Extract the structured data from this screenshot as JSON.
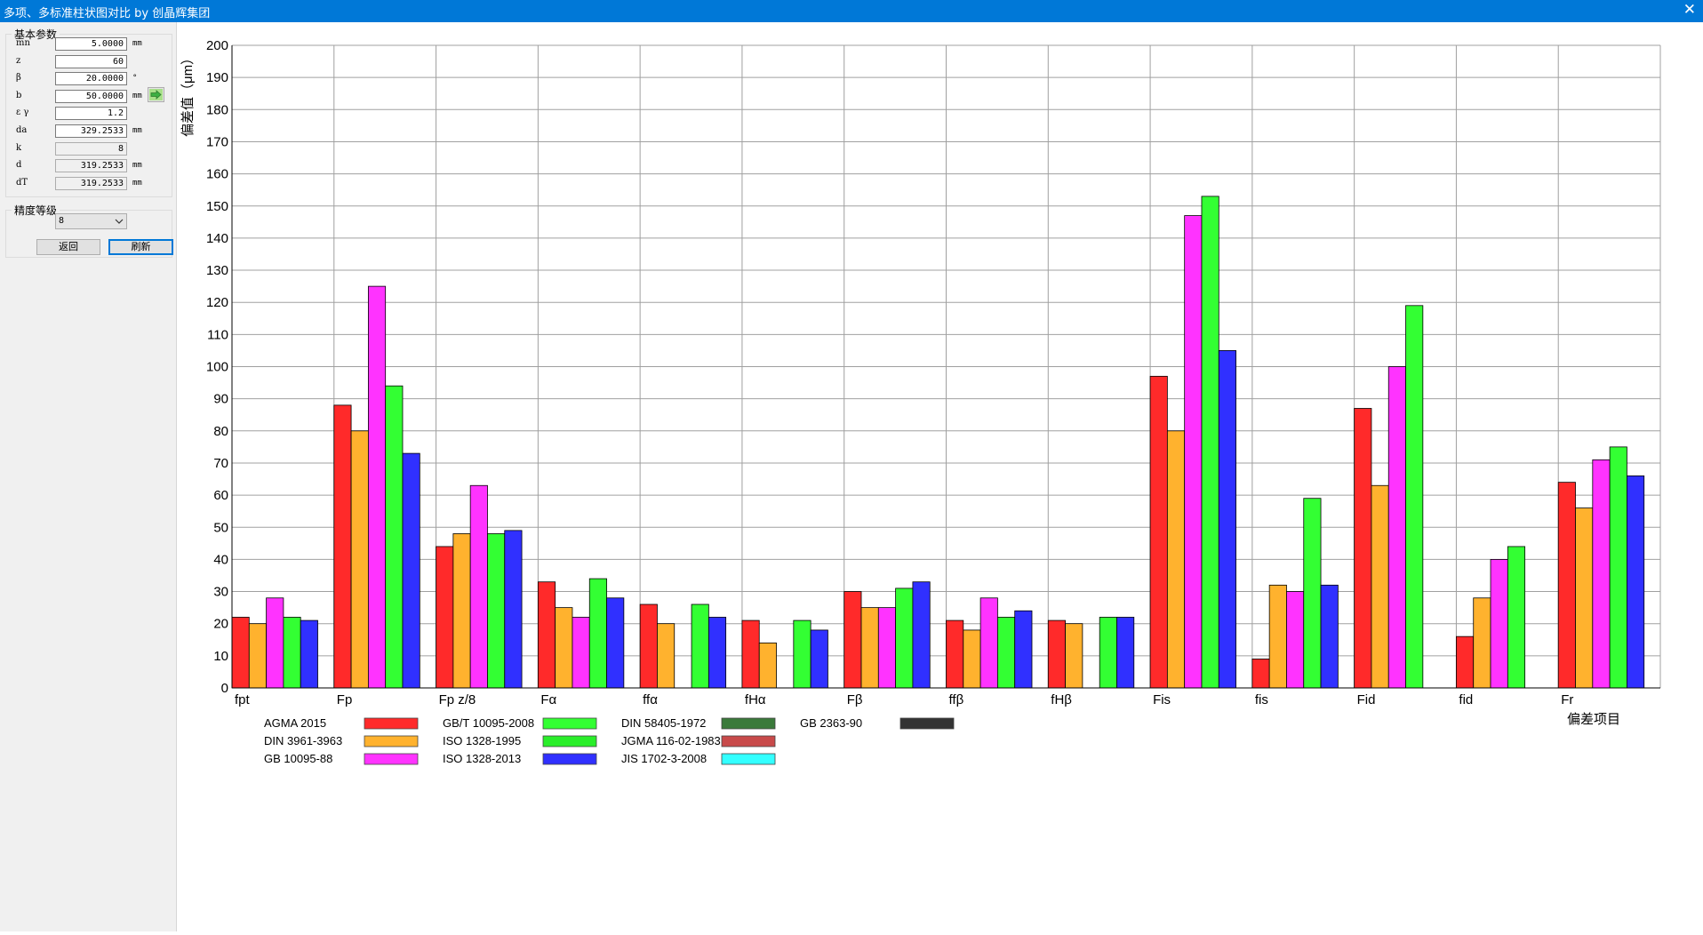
{
  "window": {
    "title": "多项、多标准柱状图对比 by 创晶辉集团",
    "close_label": "✕"
  },
  "params": {
    "group_title": "基本参数",
    "rows": [
      {
        "label": "mn",
        "value": "5.0000",
        "unit": "mm",
        "readonly": false
      },
      {
        "label": "z",
        "value": "60",
        "unit": "",
        "readonly": false
      },
      {
        "label": "β",
        "value": "20.0000",
        "unit": "°",
        "readonly": false
      },
      {
        "label": "b",
        "value": "50.0000",
        "unit": "mm",
        "readonly": false
      },
      {
        "label": "ε γ",
        "value": "1.2",
        "unit": "",
        "readonly": false
      },
      {
        "label": "da",
        "value": "329.2533",
        "unit": "mm",
        "readonly": false
      },
      {
        "label": "k",
        "value": "8",
        "unit": "",
        "readonly": true
      },
      {
        "label": "d",
        "value": "319.2533",
        "unit": "mm",
        "readonly": true
      },
      {
        "label": "dT",
        "value": "319.2533",
        "unit": "mm",
        "readonly": true
      }
    ],
    "go_icon": "green-arrow-right-icon"
  },
  "precision": {
    "group_title": "精度等级",
    "selected": "8"
  },
  "buttons": {
    "back": "返回",
    "refresh": "刷新"
  },
  "chart_data": {
    "type": "bar",
    "title": "",
    "ylabel": "偏差值（μm）",
    "xlabel": "偏差项目",
    "ylim": [
      0,
      200
    ],
    "ytick_step": 10,
    "grid": true,
    "legend_position": "bottom",
    "categories": [
      "fpt",
      "Fp",
      "Fp z/8",
      "Fα",
      "ffα",
      "fHα",
      "Fβ",
      "ffβ",
      "fHβ",
      "Fis",
      "fis",
      "Fid",
      "fid",
      "Fr"
    ],
    "series": [
      {
        "name": "AGMA 2015",
        "color": "#ff2a2a",
        "values": [
          22,
          88,
          44,
          33,
          26,
          21,
          30,
          21,
          21,
          97,
          9,
          87,
          16,
          64
        ]
      },
      {
        "name": "DIN 3961-3963",
        "color": "#ffb22e",
        "values": [
          20,
          80,
          48,
          25,
          20,
          14,
          25,
          18,
          20,
          80,
          32,
          63,
          28,
          56
        ]
      },
      {
        "name": "GB 10095-88",
        "color": "#ff33ff",
        "values": [
          28,
          125,
          63,
          22,
          null,
          null,
          25,
          28,
          null,
          147,
          30,
          100,
          40,
          71
        ]
      },
      {
        "name": "GB/T 10095-2008",
        "color": "#33ff33",
        "values": [
          22,
          94,
          48,
          34,
          26,
          21,
          31,
          22,
          22,
          153,
          59,
          119,
          44,
          75
        ]
      },
      {
        "name": "ISO 1328-1995",
        "color": "#2aee2a",
        "values": [
          null,
          null,
          null,
          null,
          null,
          null,
          null,
          null,
          null,
          null,
          null,
          null,
          null,
          null
        ]
      },
      {
        "name": "ISO 1328-2013",
        "color": "#3030ff",
        "values": [
          21,
          73,
          49,
          28,
          22,
          18,
          33,
          24,
          22,
          105,
          32,
          null,
          null,
          66
        ]
      },
      {
        "name": "DIN 58405-1972",
        "color": "#3a7a3a",
        "values": [
          null,
          null,
          null,
          null,
          null,
          null,
          null,
          null,
          null,
          null,
          null,
          null,
          null,
          null
        ]
      },
      {
        "name": "JGMA 116-02-1983",
        "color": "#c84a4a",
        "values": [
          null,
          null,
          null,
          null,
          null,
          null,
          null,
          null,
          null,
          null,
          null,
          null,
          null,
          null
        ]
      },
      {
        "name": "JIS 1702-3-2008",
        "color": "#33ffff",
        "values": [
          null,
          null,
          null,
          null,
          null,
          null,
          null,
          null,
          null,
          null,
          null,
          null,
          null,
          null
        ]
      },
      {
        "name": "GB 2363-90",
        "color": "#333333",
        "values": [
          null,
          null,
          null,
          null,
          null,
          null,
          null,
          null,
          null,
          null,
          null,
          null,
          null,
          null
        ]
      }
    ],
    "plotted_series": [
      "AGMA 2015",
      "DIN 3961-3963",
      "GB 10095-88",
      "GB/T 10095-2008",
      "ISO 1328-2013"
    ],
    "legend_columns": [
      [
        "AGMA 2015",
        "DIN 3961-3963",
        "GB 10095-88"
      ],
      [
        "GB/T 10095-2008",
        "ISO 1328-1995",
        "ISO 1328-2013"
      ],
      [
        "DIN 58405-1972",
        "JGMA 116-02-1983",
        "JIS 1702-3-2008"
      ],
      [
        "GB 2363-90"
      ]
    ]
  }
}
